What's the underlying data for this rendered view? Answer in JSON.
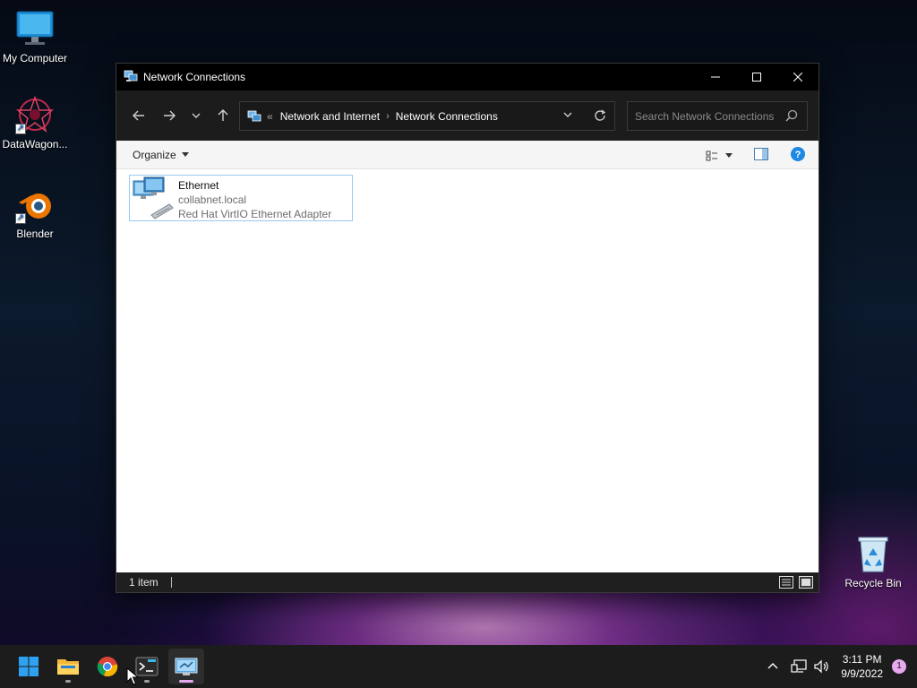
{
  "desktop": {
    "icons": [
      {
        "label": "My Computer"
      },
      {
        "label": "DataWagon..."
      },
      {
        "label": "Blender"
      },
      {
        "label": "Recycle Bin"
      }
    ]
  },
  "window": {
    "title": "Network Connections",
    "nav": {
      "overflow": "«",
      "crumbs": [
        "Network and Internet",
        "Network Connections"
      ],
      "search_placeholder": "Search Network Connections"
    },
    "toolbar": {
      "organize_label": "Organize"
    },
    "items": [
      {
        "name": "Ethernet",
        "network": "collabnet.local",
        "adapter": "Red Hat VirtIO Ethernet Adapter"
      }
    ],
    "status": {
      "count_text": "1 item"
    }
  },
  "taskbar": {
    "clock": {
      "time": "3:11 PM",
      "date": "9/9/2022"
    },
    "notification_count": "1"
  },
  "colors": {
    "accent": "#0078d4",
    "selection_border": "#99c9ef",
    "taskbar_bg": "#1c1c1c",
    "titlebar_bg": "#000000"
  },
  "icons": [
    "monitor-icon",
    "datawagon-icon",
    "blender-icon",
    "recycle-bin-icon",
    "network-icon",
    "start-icon",
    "file-explorer-icon",
    "chrome-icon",
    "terminal-icon",
    "control-panel-icon",
    "help-icon",
    "search-icon",
    "refresh-icon"
  ]
}
